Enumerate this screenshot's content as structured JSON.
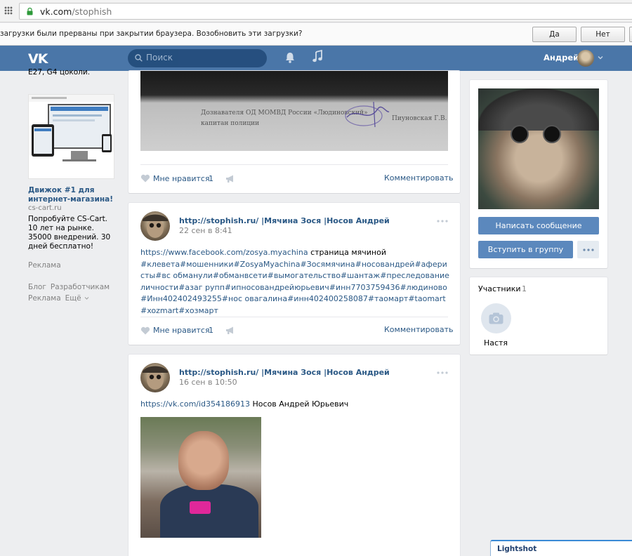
{
  "browser": {
    "url_host": "vk.com",
    "url_path": "/stophish"
  },
  "infobar": {
    "message": "загрузки были прерваны при закрытии браузера. Возобновить эти загрузки?",
    "yes_label": "Да",
    "no_label": "Нет"
  },
  "header": {
    "logo": "VK",
    "search_placeholder": "Поиск",
    "user_name": "Андрей"
  },
  "left": {
    "top_text": "E27, G4 цоколи.",
    "ad_title": "Движок #1 для интернет-магазина!",
    "ad_domain": "cs-cart.ru",
    "ad_description": "Попробуйте CS-Cart. 10 лет на рынке. 35000 внедрений. 30 дней бесплатно!",
    "ad_label": "Реклама",
    "footer": [
      "Блог",
      "Разработчикам",
      "Реклама",
      "Ещё"
    ]
  },
  "posts": [
    {
      "document_text_1": "Дознавателя ОД МОМВД России «Людиновский»",
      "document_text_2": "капитан полиции",
      "document_text_3": "Пиуновская Г.В.",
      "like_label": "Мне нравится",
      "like_count": "1",
      "comment_label": "Комментировать"
    },
    {
      "author": "http://stophish.ru/ |Мячина Зося |Носов Андрей",
      "date": "22 сен в 8:41",
      "link": "https://www.facebook.com/zosya.myachina",
      "link_suffix": " страница мячиной",
      "hashtags": "#клевета#мошенники#ZosyaMyachina#Зосямячина#носовандрей#аферисты#вс обманули#обманвсети#вымогательство#шантаж#преследованиеличности#азаг рупп#ипносовандрейюрьевич#инн7703759436#людиново#Инн402402493255#нос овагалина#инн402400258087#таомарт#taomart#xozmart#хозмарт",
      "like_label": "Мне нравится",
      "like_count": "1",
      "comment_label": "Комментировать"
    },
    {
      "author": "http://stophish.ru/ |Мячина Зося |Носов Андрей",
      "date": "16 сен в 10:50",
      "link": "https://vk.com/id354186913",
      "link_suffix": " Носов Андрей Юрьевич"
    }
  ],
  "right": {
    "write_message": "Написать сообщение",
    "join_group": "Вступить в группу",
    "members_title": "Участники",
    "members_count": "1",
    "member_name": "Настя"
  },
  "lightshot": {
    "label": "Lightshot"
  },
  "colors": {
    "vk_blue": "#4a76a8",
    "link": "#2a5885",
    "button": "#5b88bd",
    "page_bg": "#edeef0"
  }
}
